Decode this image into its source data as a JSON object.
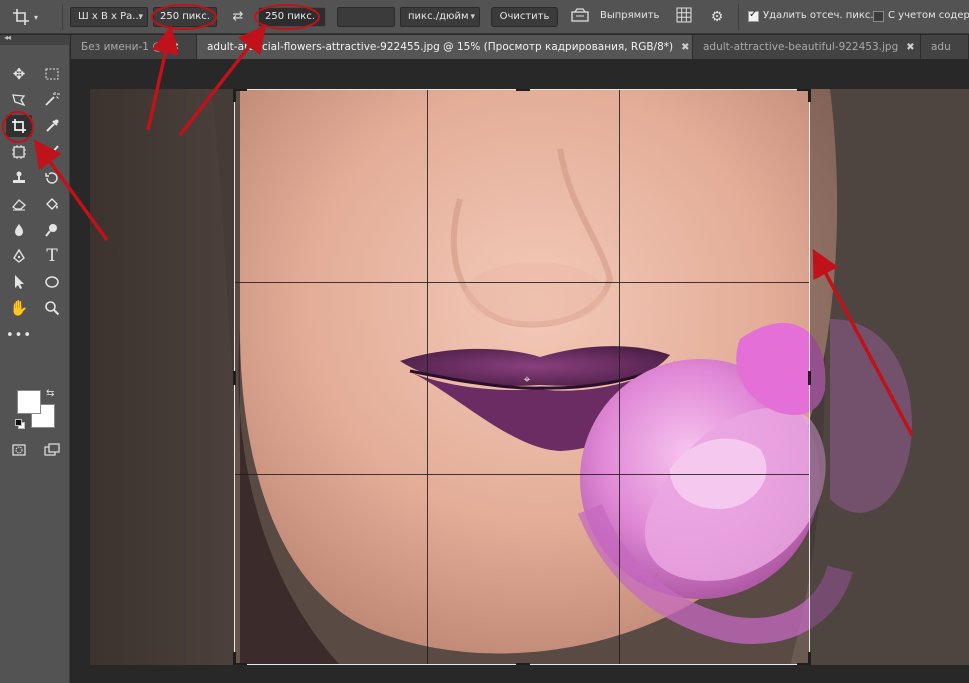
{
  "options_bar": {
    "ratio_preset": "Ш x В x Ра...",
    "width_value": "250 пикс.",
    "height_value": "250 пикс.",
    "resolution_value": "",
    "resolution_unit": "пикс./дюйм",
    "clear_label": "Очистить",
    "straighten_label": "Выпрямить",
    "delete_cropped_label": "Удалить отсеч. пикс.",
    "delete_cropped_checked": true,
    "content_aware_label": "С учетом содерж",
    "content_aware_checked": false
  },
  "tabs": [
    {
      "label": "Без имени-1 @",
      "active": false
    },
    {
      "label": "adult-artificial-flowers-attractive-922455.jpg @ 15% (Просмотр кадрирования, RGB/8*)",
      "active": true
    },
    {
      "label": "adult-attractive-beautiful-922453.jpg",
      "active": false
    },
    {
      "label": "adu",
      "active": false
    }
  ],
  "toolbar": {
    "selected_tool": "crop-tool",
    "foreground_color": "#ffffff",
    "background_color": "#ffffff"
  },
  "annotation": {
    "arrow_color": "#c0121a",
    "highlight_color": "#c0121a"
  }
}
